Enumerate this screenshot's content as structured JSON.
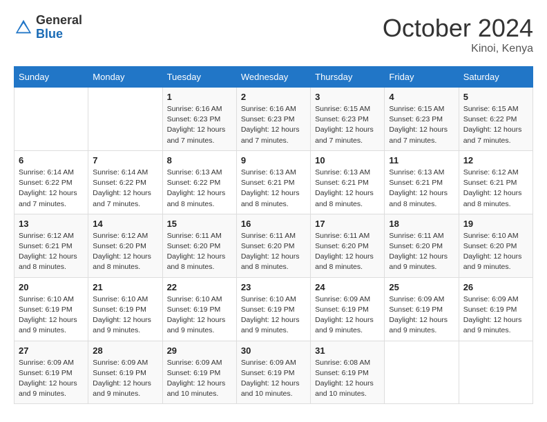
{
  "logo": {
    "general": "General",
    "blue": "Blue"
  },
  "title": {
    "month": "October 2024",
    "location": "Kinoi, Kenya"
  },
  "weekdays": [
    "Sunday",
    "Monday",
    "Tuesday",
    "Wednesday",
    "Thursday",
    "Friday",
    "Saturday"
  ],
  "weeks": [
    [
      {
        "day": "",
        "info": ""
      },
      {
        "day": "",
        "info": ""
      },
      {
        "day": "1",
        "info": "Sunrise: 6:16 AM\nSunset: 6:23 PM\nDaylight: 12 hours and 7 minutes."
      },
      {
        "day": "2",
        "info": "Sunrise: 6:16 AM\nSunset: 6:23 PM\nDaylight: 12 hours and 7 minutes."
      },
      {
        "day": "3",
        "info": "Sunrise: 6:15 AM\nSunset: 6:23 PM\nDaylight: 12 hours and 7 minutes."
      },
      {
        "day": "4",
        "info": "Sunrise: 6:15 AM\nSunset: 6:23 PM\nDaylight: 12 hours and 7 minutes."
      },
      {
        "day": "5",
        "info": "Sunrise: 6:15 AM\nSunset: 6:22 PM\nDaylight: 12 hours and 7 minutes."
      }
    ],
    [
      {
        "day": "6",
        "info": "Sunrise: 6:14 AM\nSunset: 6:22 PM\nDaylight: 12 hours and 7 minutes."
      },
      {
        "day": "7",
        "info": "Sunrise: 6:14 AM\nSunset: 6:22 PM\nDaylight: 12 hours and 7 minutes."
      },
      {
        "day": "8",
        "info": "Sunrise: 6:13 AM\nSunset: 6:22 PM\nDaylight: 12 hours and 8 minutes."
      },
      {
        "day": "9",
        "info": "Sunrise: 6:13 AM\nSunset: 6:21 PM\nDaylight: 12 hours and 8 minutes."
      },
      {
        "day": "10",
        "info": "Sunrise: 6:13 AM\nSunset: 6:21 PM\nDaylight: 12 hours and 8 minutes."
      },
      {
        "day": "11",
        "info": "Sunrise: 6:13 AM\nSunset: 6:21 PM\nDaylight: 12 hours and 8 minutes."
      },
      {
        "day": "12",
        "info": "Sunrise: 6:12 AM\nSunset: 6:21 PM\nDaylight: 12 hours and 8 minutes."
      }
    ],
    [
      {
        "day": "13",
        "info": "Sunrise: 6:12 AM\nSunset: 6:21 PM\nDaylight: 12 hours and 8 minutes."
      },
      {
        "day": "14",
        "info": "Sunrise: 6:12 AM\nSunset: 6:20 PM\nDaylight: 12 hours and 8 minutes."
      },
      {
        "day": "15",
        "info": "Sunrise: 6:11 AM\nSunset: 6:20 PM\nDaylight: 12 hours and 8 minutes."
      },
      {
        "day": "16",
        "info": "Sunrise: 6:11 AM\nSunset: 6:20 PM\nDaylight: 12 hours and 8 minutes."
      },
      {
        "day": "17",
        "info": "Sunrise: 6:11 AM\nSunset: 6:20 PM\nDaylight: 12 hours and 8 minutes."
      },
      {
        "day": "18",
        "info": "Sunrise: 6:11 AM\nSunset: 6:20 PM\nDaylight: 12 hours and 9 minutes."
      },
      {
        "day": "19",
        "info": "Sunrise: 6:10 AM\nSunset: 6:20 PM\nDaylight: 12 hours and 9 minutes."
      }
    ],
    [
      {
        "day": "20",
        "info": "Sunrise: 6:10 AM\nSunset: 6:19 PM\nDaylight: 12 hours and 9 minutes."
      },
      {
        "day": "21",
        "info": "Sunrise: 6:10 AM\nSunset: 6:19 PM\nDaylight: 12 hours and 9 minutes."
      },
      {
        "day": "22",
        "info": "Sunrise: 6:10 AM\nSunset: 6:19 PM\nDaylight: 12 hours and 9 minutes."
      },
      {
        "day": "23",
        "info": "Sunrise: 6:10 AM\nSunset: 6:19 PM\nDaylight: 12 hours and 9 minutes."
      },
      {
        "day": "24",
        "info": "Sunrise: 6:09 AM\nSunset: 6:19 PM\nDaylight: 12 hours and 9 minutes."
      },
      {
        "day": "25",
        "info": "Sunrise: 6:09 AM\nSunset: 6:19 PM\nDaylight: 12 hours and 9 minutes."
      },
      {
        "day": "26",
        "info": "Sunrise: 6:09 AM\nSunset: 6:19 PM\nDaylight: 12 hours and 9 minutes."
      }
    ],
    [
      {
        "day": "27",
        "info": "Sunrise: 6:09 AM\nSunset: 6:19 PM\nDaylight: 12 hours and 9 minutes."
      },
      {
        "day": "28",
        "info": "Sunrise: 6:09 AM\nSunset: 6:19 PM\nDaylight: 12 hours and 9 minutes."
      },
      {
        "day": "29",
        "info": "Sunrise: 6:09 AM\nSunset: 6:19 PM\nDaylight: 12 hours and 10 minutes."
      },
      {
        "day": "30",
        "info": "Sunrise: 6:09 AM\nSunset: 6:19 PM\nDaylight: 12 hours and 10 minutes."
      },
      {
        "day": "31",
        "info": "Sunrise: 6:08 AM\nSunset: 6:19 PM\nDaylight: 12 hours and 10 minutes."
      },
      {
        "day": "",
        "info": ""
      },
      {
        "day": "",
        "info": ""
      }
    ]
  ]
}
